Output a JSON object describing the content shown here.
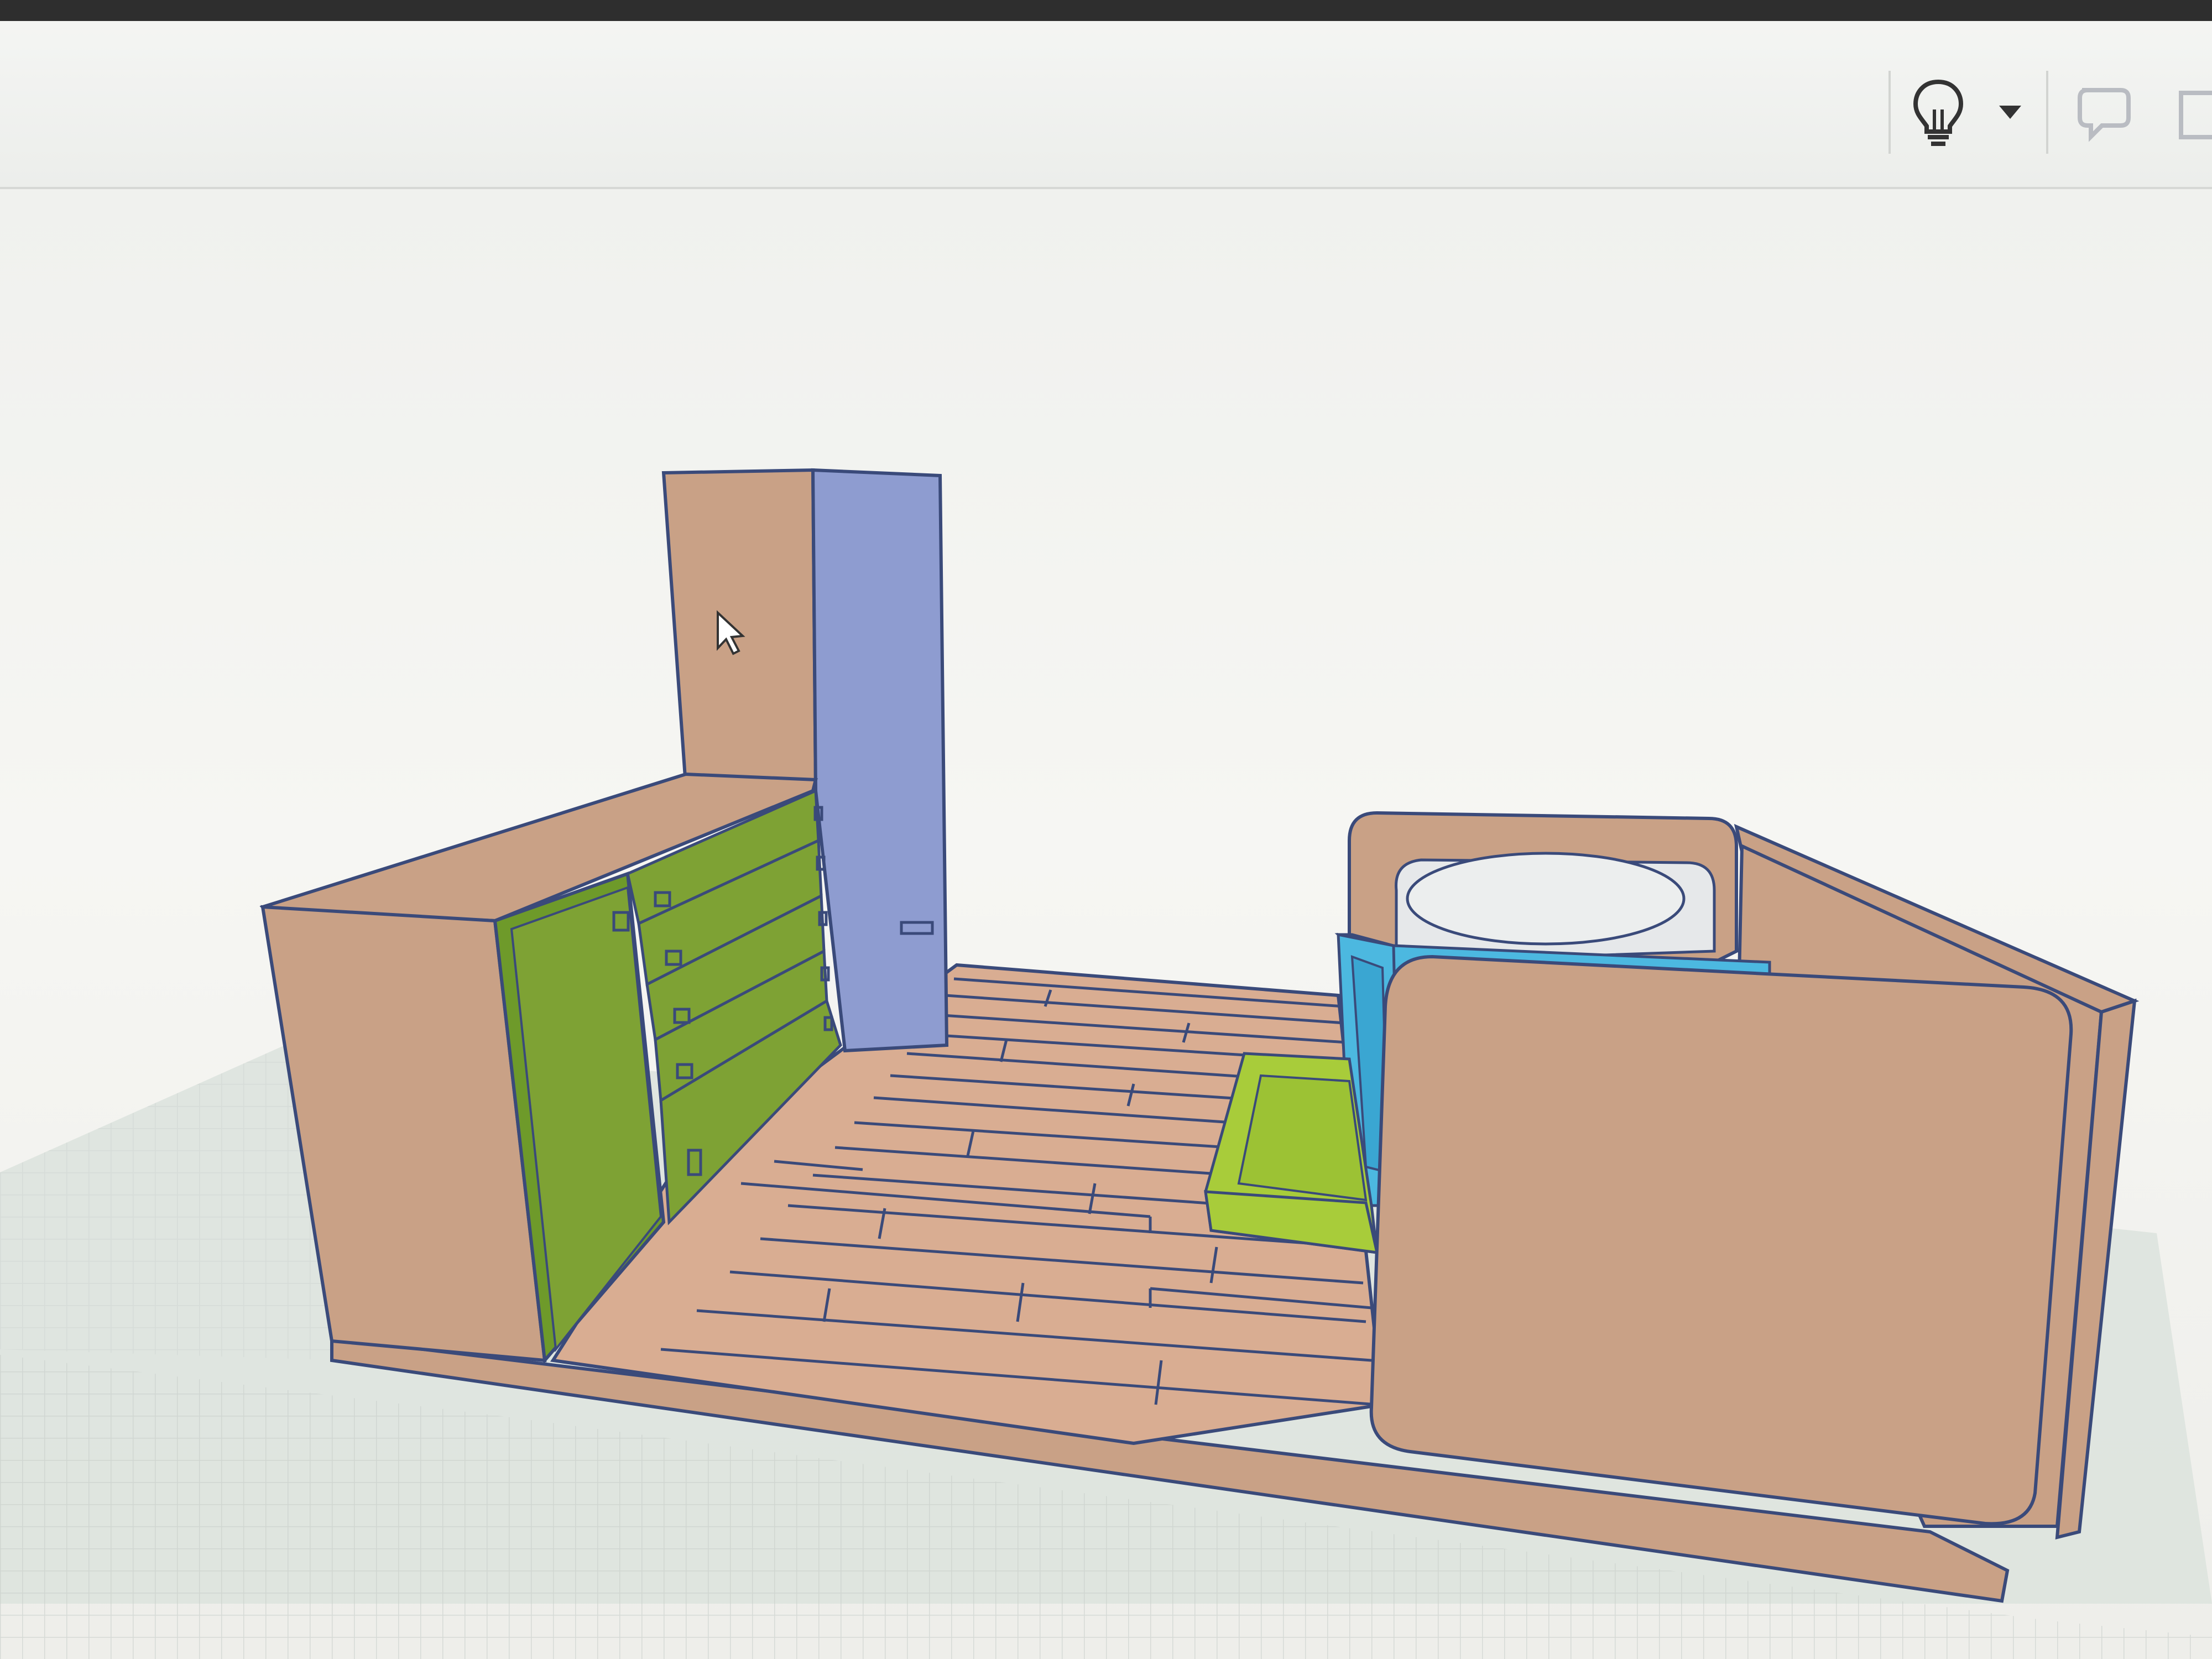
{
  "app": {
    "toolbar": {
      "buttons": [
        {
          "name": "lightbulb-icon",
          "role": "hint-button"
        },
        {
          "name": "caret-down-icon",
          "role": "hint-dropdown"
        },
        {
          "name": "speech-bubble-icon",
          "role": "notes-button"
        },
        {
          "name": "panel-icon",
          "role": "panel-button"
        }
      ]
    }
  },
  "scene": {
    "objects": [
      {
        "name": "tall-cabinet",
        "color": "#c9a186"
      },
      {
        "name": "tall-cabinet-side-panel",
        "color": "#8e9cd0"
      },
      {
        "name": "dresser",
        "color": "#c9a186"
      },
      {
        "name": "dresser-door",
        "color": "#6e9a2a"
      },
      {
        "name": "dresser-drawers",
        "color": "#7ea234"
      },
      {
        "name": "bathtub",
        "color": "#c9a186"
      },
      {
        "name": "blue-drawer-unit",
        "color": "#4cb8e0"
      },
      {
        "name": "green-pull-out-drawer",
        "color": "#a8cc3a"
      },
      {
        "name": "wood-floor",
        "color": "#d9ad92"
      },
      {
        "name": "front-wall-panel",
        "color": "#c9a186"
      }
    ],
    "colors": {
      "outline": "#3a4a7a",
      "wood": "#c9a186",
      "floor": "#d9ad92",
      "green": "#7ea234",
      "lime": "#a8cc3a",
      "blue": "#4cb8e0",
      "lavender": "#8e9cd0"
    }
  }
}
